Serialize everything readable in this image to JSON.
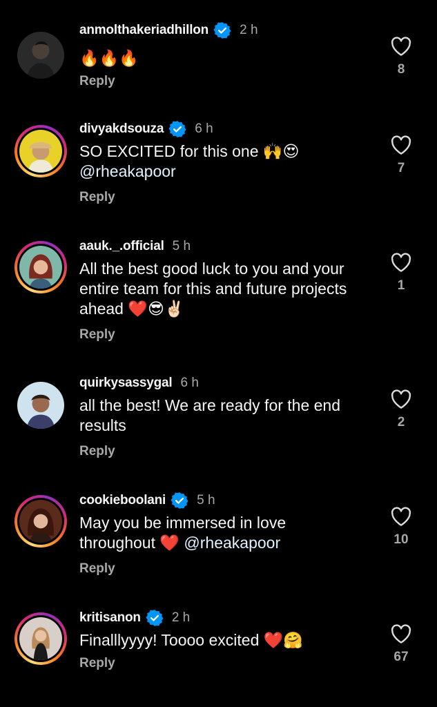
{
  "comments": [
    {
      "username": "anmolthakeriadhillon",
      "verified": true,
      "time": "2 h",
      "text": "🔥🔥🔥",
      "mention": "",
      "reply_label": "Reply",
      "likes": "8",
      "story_ring": false
    },
    {
      "username": "divyakdsouza",
      "verified": true,
      "time": "6 h",
      "text": "SO EXCITED for this one 🙌😍",
      "mention": "@rheakapoor",
      "reply_label": "Reply",
      "likes": "7",
      "story_ring": true
    },
    {
      "username": "aauk._.official",
      "verified": false,
      "time": "5 h",
      "text": "All the best good luck to you and your entire team for this and future projects ahead ❤️😎✌🏻",
      "mention": "",
      "reply_label": "Reply",
      "likes": "1",
      "story_ring": true
    },
    {
      "username": "quirkysassygal",
      "verified": false,
      "time": "6 h",
      "text": "all the best! We are ready for the end results",
      "mention": "",
      "reply_label": "Reply",
      "likes": "2",
      "story_ring": false
    },
    {
      "username": "cookieboolani",
      "verified": true,
      "time": "5 h",
      "text": "May you be immersed in love throughout ❤️",
      "mention": "@rheakapoor",
      "reply_label": "Reply",
      "likes": "10",
      "story_ring": true
    },
    {
      "username": "kritisanon",
      "verified": true,
      "time": "2 h",
      "text": "Finalllyyyy! Toooo excited ❤️🤗",
      "mention": "",
      "reply_label": "Reply",
      "likes": "67",
      "story_ring": true
    }
  ],
  "colors": {
    "background": "#000000",
    "verified_badge": "#0095f6",
    "muted_text": "#a8a8a8"
  },
  "icons": {
    "verified": "verified-badge-icon",
    "like": "heart-outline-icon"
  }
}
